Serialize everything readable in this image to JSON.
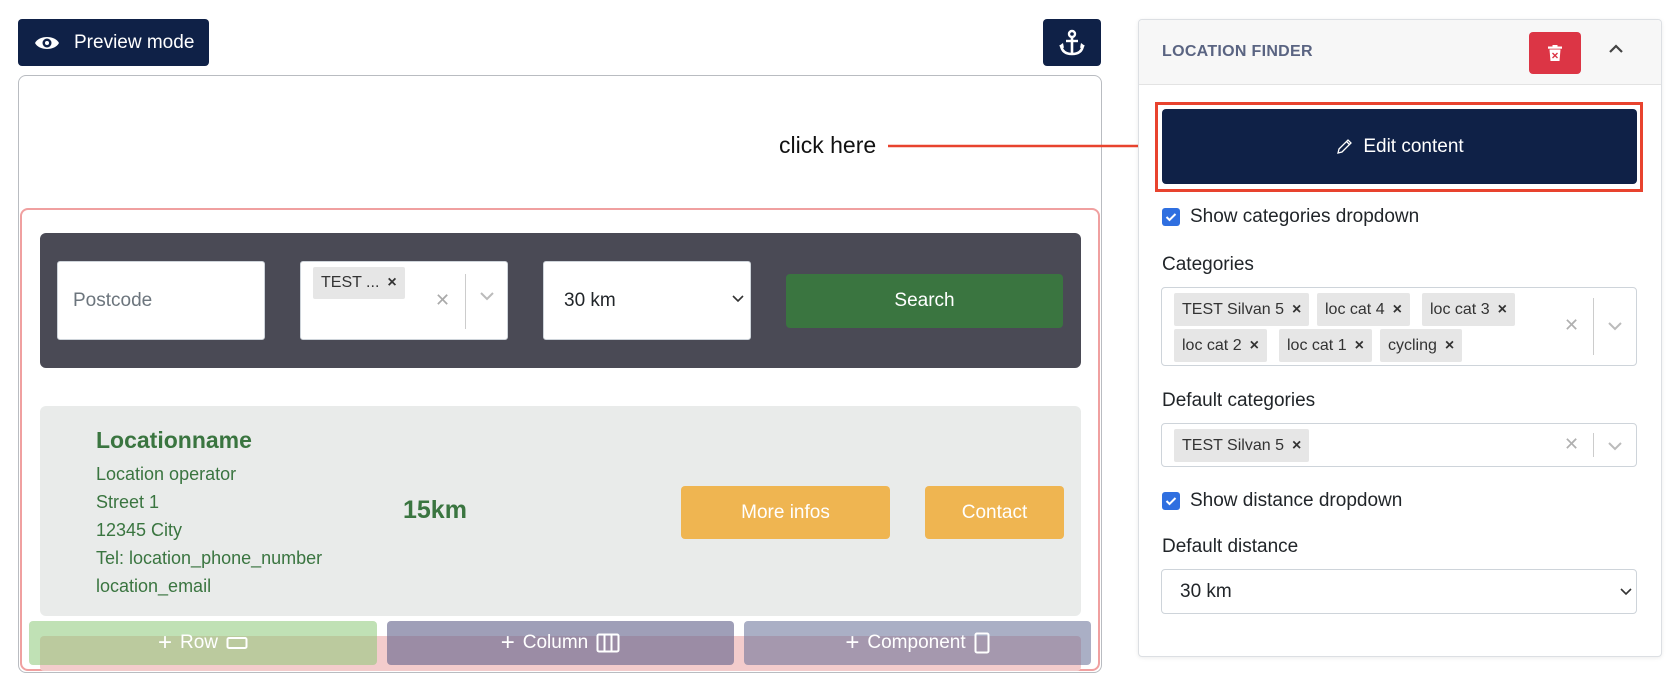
{
  "toolbar": {
    "preview_label": "Preview mode"
  },
  "annotation": {
    "hint": "click here"
  },
  "finder": {
    "postcode_placeholder": "Postcode",
    "category_chip": "TEST ...",
    "distance_value": "30 km",
    "search_label": "Search"
  },
  "result": {
    "name": "Locationname",
    "operator": "Location operator",
    "street": "Street 1",
    "city": "12345 City",
    "phone": "Tel: location_phone_number",
    "email": "location_email",
    "distance": "15km",
    "more_label": "More infos",
    "contact_label": "Contact"
  },
  "builder": {
    "row_label": "Row",
    "column_label": "Column",
    "component_label": "Component"
  },
  "panel": {
    "title": "LOCATION FINDER",
    "edit_label": "Edit content",
    "show_categories_label": "Show categories dropdown",
    "categories_label": "Categories",
    "categories": [
      "TEST Silvan 5",
      "loc cat 4",
      "loc cat 3",
      "loc cat 2",
      "loc cat 1",
      "cycling"
    ],
    "default_categories_label": "Default categories",
    "default_categories": [
      "TEST Silvan 5"
    ],
    "show_distance_label": "Show distance dropdown",
    "default_distance_label": "Default distance",
    "default_distance_value": "30 km"
  },
  "colors": {
    "navy": "#0f2147",
    "green": "#3a7540",
    "amber": "#efb551",
    "danger": "#dc3545",
    "highlight": "#e8432e",
    "checkbox": "#2f6fe0"
  },
  "icons": {
    "preview": "eye-icon",
    "anchor": "anchor-icon",
    "delete": "trash-icon",
    "collapse": "chevron-up-icon",
    "edit": "pencil-icon",
    "remove": "close-icon"
  }
}
